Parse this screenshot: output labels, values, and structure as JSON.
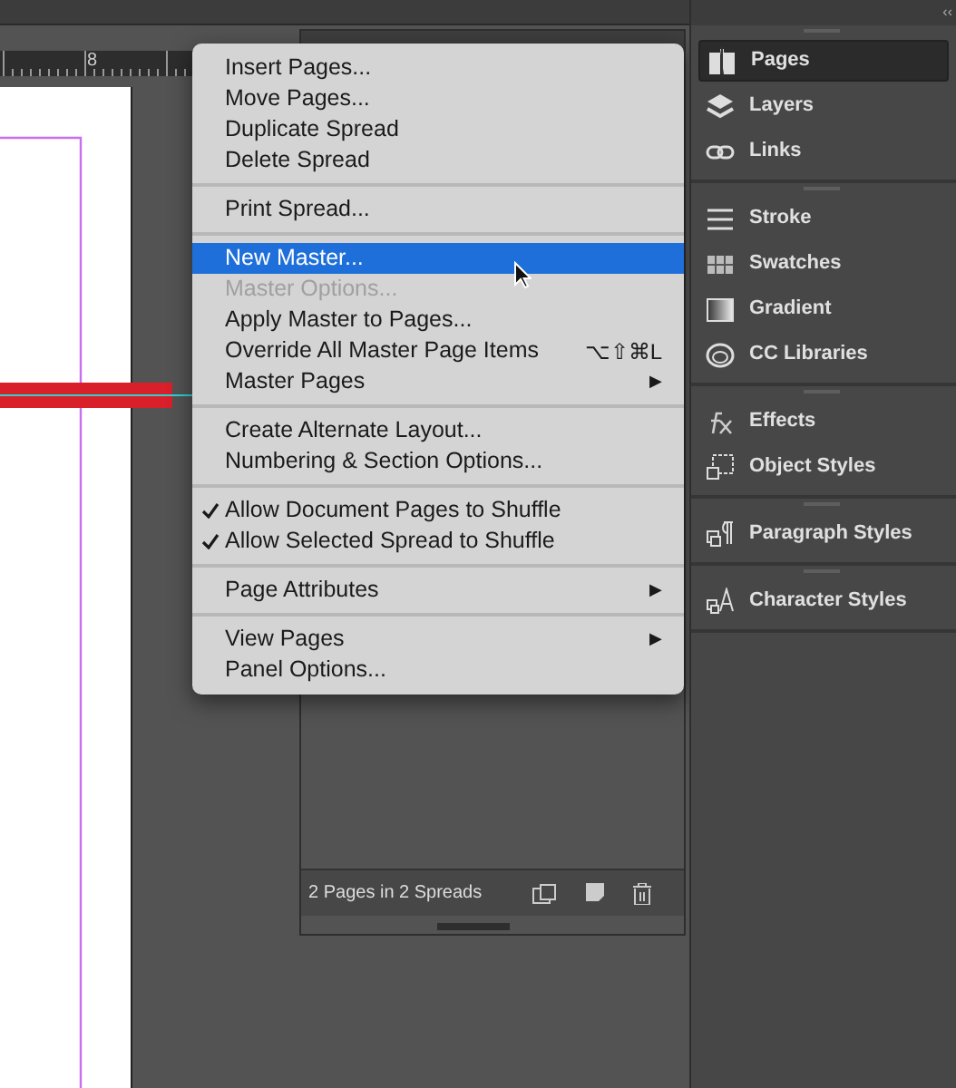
{
  "ruler": {
    "label": "8"
  },
  "menu": {
    "items": [
      {
        "kind": "item",
        "label": "Insert Pages...",
        "selected": false,
        "disabled": false,
        "checked": false
      },
      {
        "kind": "item",
        "label": "Move Pages...",
        "selected": false,
        "disabled": false,
        "checked": false
      },
      {
        "kind": "item",
        "label": "Duplicate Spread",
        "selected": false,
        "disabled": false,
        "checked": false
      },
      {
        "kind": "item",
        "label": "Delete Spread",
        "selected": false,
        "disabled": false,
        "checked": false
      },
      {
        "kind": "separator"
      },
      {
        "kind": "item",
        "label": "Print Spread...",
        "selected": false,
        "disabled": false,
        "checked": false
      },
      {
        "kind": "separator"
      },
      {
        "kind": "item",
        "label": "New Master...",
        "selected": true,
        "disabled": false,
        "checked": false
      },
      {
        "kind": "item",
        "label": "Master Options...",
        "selected": false,
        "disabled": true,
        "checked": false
      },
      {
        "kind": "item",
        "label": "Apply Master to Pages...",
        "selected": false,
        "disabled": false,
        "checked": false
      },
      {
        "kind": "item",
        "label": "Override All Master Page Items",
        "shortcut": "⌥⇧⌘L",
        "selected": false,
        "disabled": false,
        "checked": false
      },
      {
        "kind": "submenu",
        "label": "Master Pages",
        "arrow": "▶",
        "selected": false,
        "disabled": false,
        "checked": false
      },
      {
        "kind": "separator"
      },
      {
        "kind": "item",
        "label": "Create Alternate Layout...",
        "selected": false,
        "disabled": false,
        "checked": false
      },
      {
        "kind": "item",
        "label": "Numbering & Section Options...",
        "selected": false,
        "disabled": false,
        "checked": false
      },
      {
        "kind": "separator"
      },
      {
        "kind": "item",
        "label": "Allow Document Pages to Shuffle",
        "selected": false,
        "disabled": false,
        "checked": true
      },
      {
        "kind": "item",
        "label": "Allow Selected Spread to Shuffle",
        "selected": false,
        "disabled": false,
        "checked": true
      },
      {
        "kind": "separator"
      },
      {
        "kind": "submenu",
        "label": "Page Attributes",
        "arrow": "▶",
        "selected": false,
        "disabled": false,
        "checked": false
      },
      {
        "kind": "separator"
      },
      {
        "kind": "submenu",
        "label": "View Pages",
        "arrow": "▶",
        "selected": false,
        "disabled": false,
        "checked": false
      },
      {
        "kind": "item",
        "label": "Panel Options...",
        "selected": false,
        "disabled": false,
        "checked": false
      }
    ]
  },
  "pages_panel": {
    "status": "2 Pages in 2 Spreads"
  },
  "dock": {
    "collapse": "‹‹",
    "groups": [
      [
        {
          "label": "Pages",
          "selected": true
        },
        {
          "label": "Layers",
          "selected": false
        },
        {
          "label": "Links",
          "selected": false
        }
      ],
      [
        {
          "label": "Stroke",
          "selected": false
        },
        {
          "label": "Swatches",
          "selected": false
        },
        {
          "label": "Gradient",
          "selected": false
        },
        {
          "label": "CC Libraries",
          "selected": false
        }
      ],
      [
        {
          "label": "Effects",
          "selected": false
        },
        {
          "label": "Object Styles",
          "selected": false
        }
      ],
      [
        {
          "label": "Paragraph Styles",
          "selected": false
        }
      ],
      [
        {
          "label": "Character Styles",
          "selected": false
        }
      ]
    ]
  }
}
